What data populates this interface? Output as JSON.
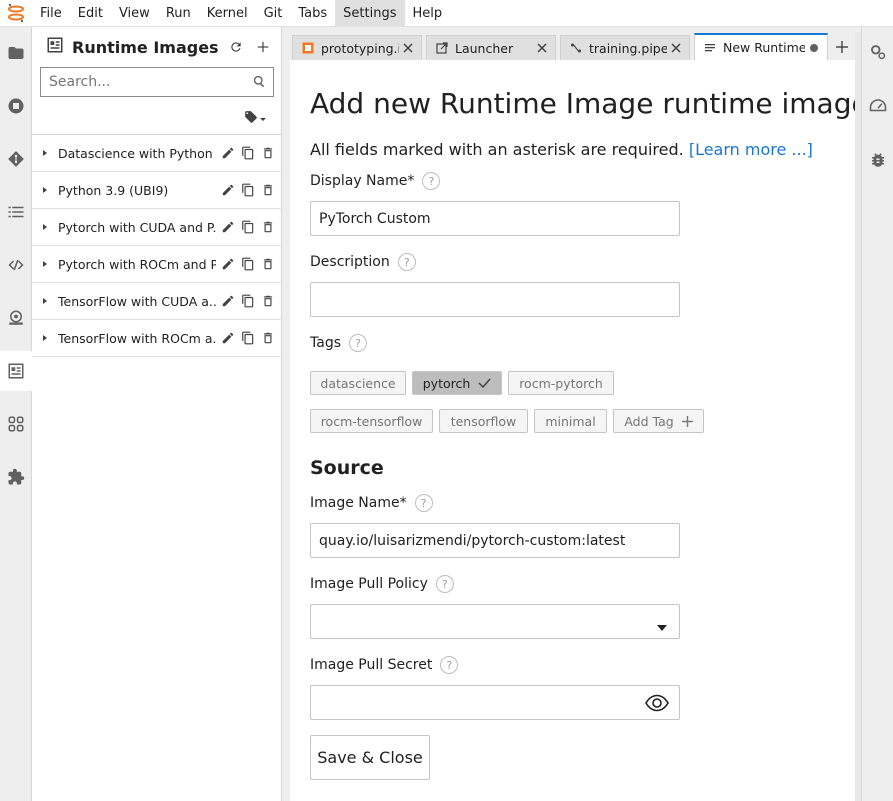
{
  "menu": [
    "File",
    "Edit",
    "View",
    "Run",
    "Kernel",
    "Git",
    "Tabs",
    "Settings",
    "Help"
  ],
  "sidebar": {
    "title": "Runtime Images",
    "search_placeholder": "Search...",
    "items": [
      {
        "label": "Datascience with Python ..."
      },
      {
        "label": "Python 3.9 (UBI9)"
      },
      {
        "label": "Pytorch with CUDA and P..."
      },
      {
        "label": "Pytorch with ROCm and P..."
      },
      {
        "label": "TensorFlow with CUDA a..."
      },
      {
        "label": "TensorFlow with ROCm a..."
      }
    ]
  },
  "tabs": [
    {
      "label": "prototyping.ipynb",
      "icon": "notebook-icon"
    },
    {
      "label": "Launcher",
      "icon": "launch-icon"
    },
    {
      "label": "training.pipeline",
      "icon": "pipeline-icon"
    },
    {
      "label": "New Runtime Image",
      "icon": "document-icon",
      "active": true
    }
  ],
  "form": {
    "title": "Add new Runtime Image runtime image",
    "intro": "All fields marked with an asterisk are required.",
    "learn_more": "[Learn more ...]",
    "display_name_label": "Display Name*",
    "display_name_value": "PyTorch Custom",
    "description_label": "Description",
    "description_value": "",
    "tags_label": "Tags",
    "tags": [
      "datascience",
      "pytorch",
      "rocm-pytorch",
      "rocm-tensorflow",
      "tensorflow",
      "minimal"
    ],
    "selected_tag": "pytorch",
    "add_tag": "Add Tag",
    "source_heading": "Source",
    "image_name_label": "Image Name*",
    "image_name_value": "quay.io/luisarizmendi/pytorch-custom:latest",
    "pull_policy_label": "Image Pull Policy",
    "pull_policy_value": "",
    "pull_secret_label": "Image Pull Secret",
    "pull_secret_value": "",
    "help_glyph": "?",
    "save_label": "Save & Close"
  },
  "colors": {
    "accent": "#1976d2",
    "logo": "#f37726"
  }
}
